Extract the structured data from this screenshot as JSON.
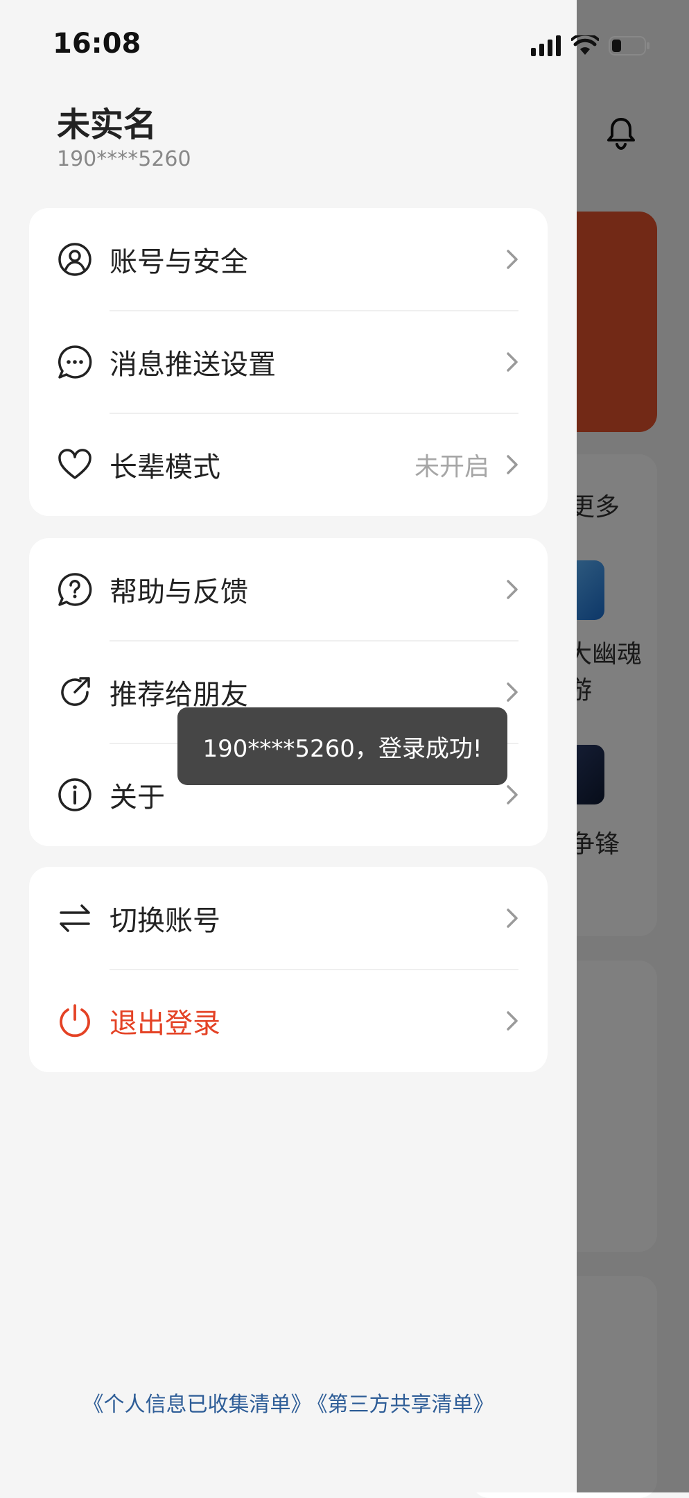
{
  "status": {
    "time": "16:08"
  },
  "profile": {
    "name": "未实名",
    "phone": "190****5260"
  },
  "menu": {
    "account_security": "账号与安全",
    "push_settings": "消息推送设置",
    "elder_mode": "长辈模式",
    "elder_mode_value": "未开启",
    "help_feedback": "帮助与反馈",
    "recommend": "推荐给朋友",
    "about": "关于",
    "switch_account": "切换账号",
    "logout": "退出登录"
  },
  "toast": {
    "message": "190****5260，登录成功!"
  },
  "footer": {
    "link1": "《个人信息已收集清单》",
    "link2": "《第三方共享清单》"
  },
  "background": {
    "more_label": "更多",
    "game1_label": "大幽魂\n游",
    "game2_label": "争锋"
  },
  "colors": {
    "danger": "#e44225",
    "link": "#2e5d97",
    "banner": "#e5532d"
  }
}
